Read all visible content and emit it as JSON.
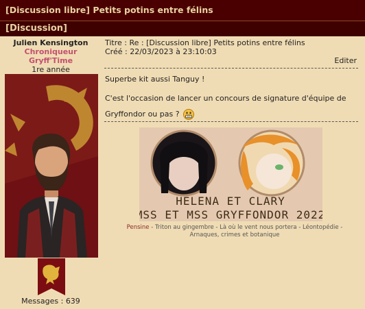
{
  "topic_title": "[Discussion libre] Petits potins entre félins",
  "forum_name": "[Discussion]",
  "author": {
    "name": "Julien Kensington",
    "rank_line1": "Chroniqueur",
    "rank_line2": "Gryff'Time",
    "year": "1re année",
    "messages": "Messages : 639"
  },
  "post": {
    "title_line": "Titre : Re : [Discussion libre] Petits potins entre félins",
    "created_line": "Créé : 22/03/2023 à 23:10:03",
    "edit_label": "Editer",
    "paragraph1": "Superbe kit aussi Tanguy !",
    "paragraph2": "C'est l'occasion de lancer un concours de signature d'équipe de Gryffondor ou pas ?"
  },
  "signature": {
    "banner_line1": "HELENA ET CLARY",
    "banner_line2": "MSS ET MSS GRYFFONDOR 2022",
    "links_first": "Pensine",
    "links_rest": " - Triton au gingembre - Là où le vent nous portera - Léontopédie - Arnaques, crimes et botanique"
  },
  "colors": {
    "header_bg": "#4a0000",
    "header_text": "#e9d3a2",
    "page_bg": "#f0dcb4",
    "rank_color": "#c2506e"
  }
}
